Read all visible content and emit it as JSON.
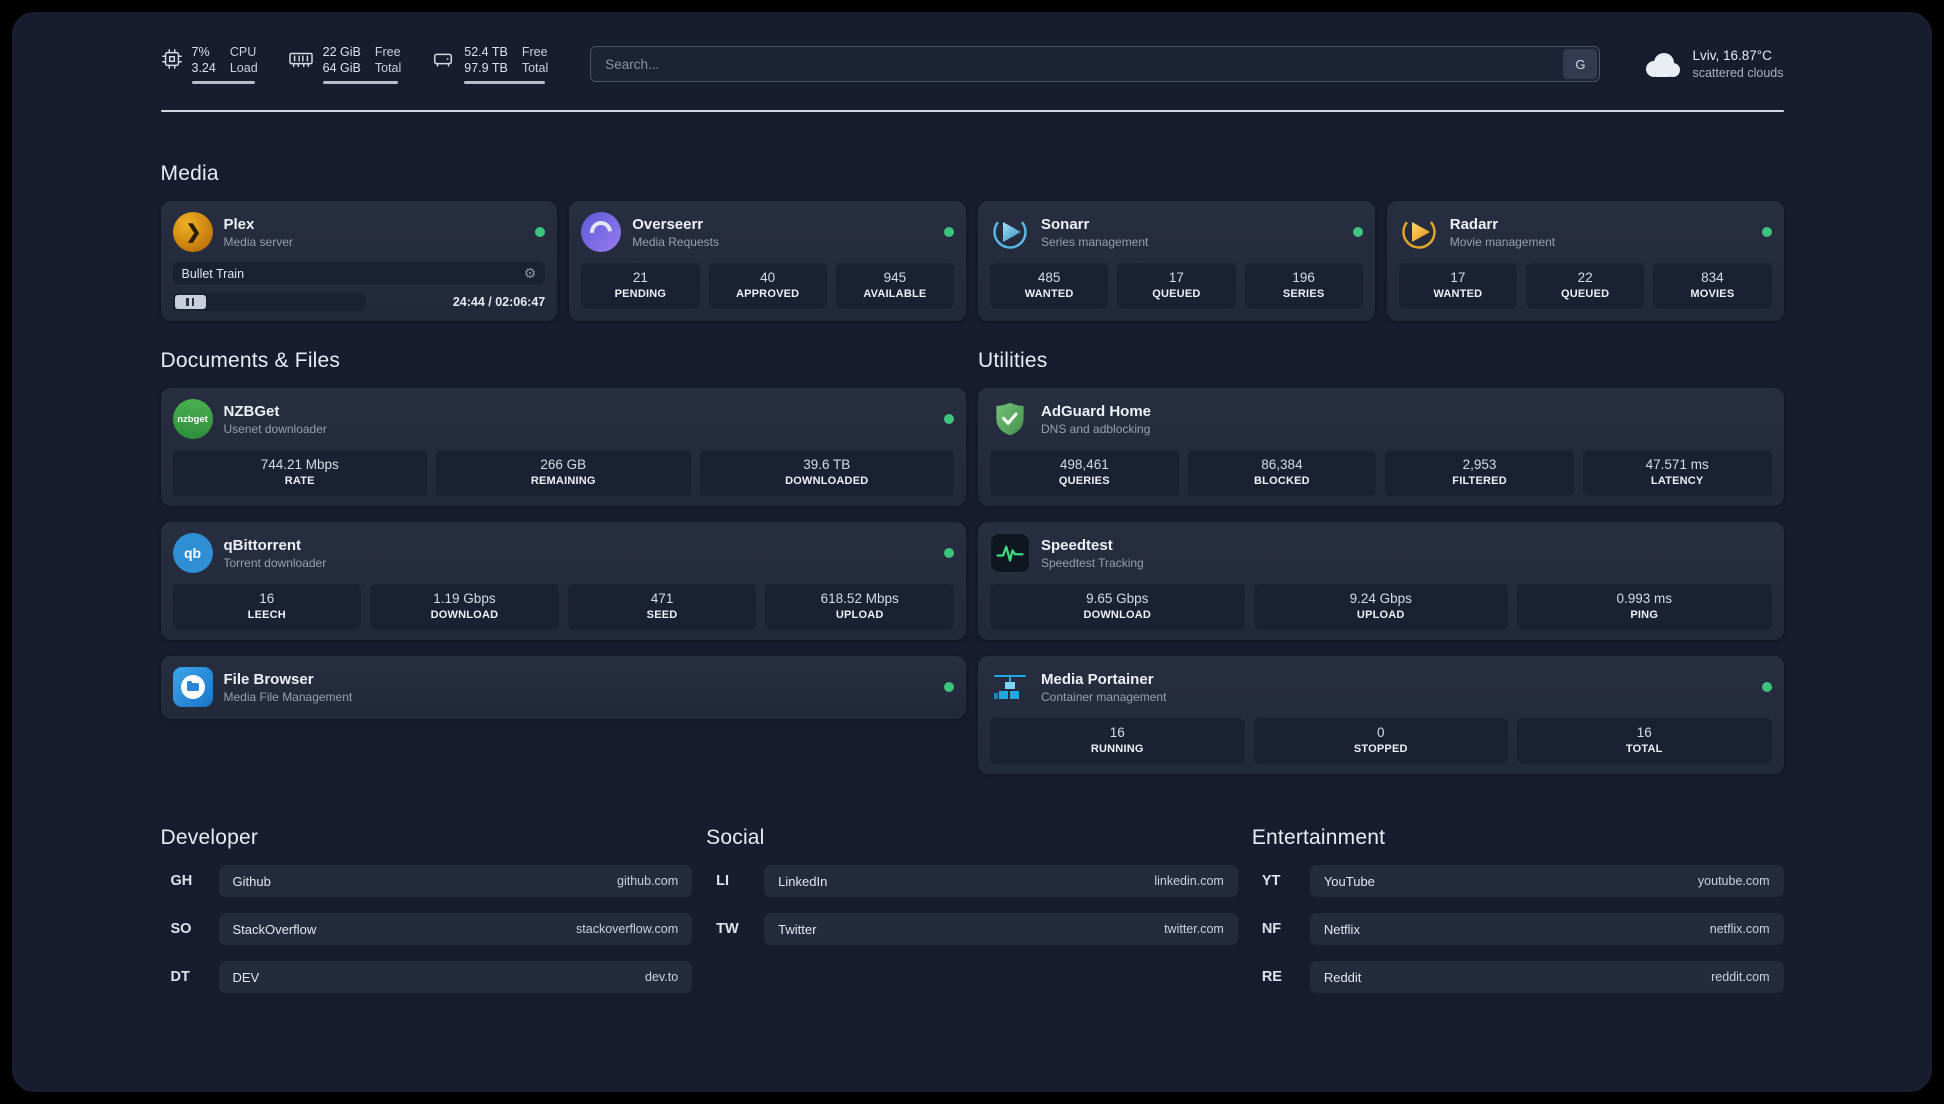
{
  "topbar": {
    "cpu": {
      "value_top": "7%",
      "value_bottom": "3.24",
      "label_top": "CPU",
      "label_bottom": "Load"
    },
    "memory": {
      "value_top": "22 GiB",
      "value_bottom": "64 GiB",
      "label_top": "Free",
      "label_bottom": "Total"
    },
    "disk": {
      "value_top": "52.4 TB",
      "value_bottom": "97.9 TB",
      "label_top": "Free",
      "label_bottom": "Total"
    },
    "search": {
      "placeholder": "Search...",
      "engine_button": "G"
    },
    "weather": {
      "location": "Lviv, 16.87°C",
      "condition": "scattered clouds"
    }
  },
  "sections": {
    "media": {
      "title": "Media",
      "apps": [
        {
          "name": "Plex",
          "subtitle": "Media server",
          "player": {
            "track": "Bullet Train",
            "time": "24:44 / 02:06:47"
          }
        },
        {
          "name": "Overseerr",
          "subtitle": "Media Requests",
          "stats": [
            {
              "value": "21",
              "label": "PENDING"
            },
            {
              "value": "40",
              "label": "APPROVED"
            },
            {
              "value": "945",
              "label": "AVAILABLE"
            }
          ]
        },
        {
          "name": "Sonarr",
          "subtitle": "Series management",
          "stats": [
            {
              "value": "485",
              "label": "WANTED"
            },
            {
              "value": "17",
              "label": "QUEUED"
            },
            {
              "value": "196",
              "label": "SERIES"
            }
          ]
        },
        {
          "name": "Radarr",
          "subtitle": "Movie management",
          "stats": [
            {
              "value": "17",
              "label": "WANTED"
            },
            {
              "value": "22",
              "label": "QUEUED"
            },
            {
              "value": "834",
              "label": "MOVIES"
            }
          ]
        }
      ]
    },
    "documents": {
      "title": "Documents & Files",
      "apps": [
        {
          "name": "NZBGet",
          "subtitle": "Usenet downloader",
          "stats": [
            {
              "value": "744.21 Mbps",
              "label": "RATE"
            },
            {
              "value": "266 GB",
              "label": "REMAINING"
            },
            {
              "value": "39.6 TB",
              "label": "DOWNLOADED"
            }
          ]
        },
        {
          "name": "qBittorrent",
          "subtitle": "Torrent downloader",
          "stats": [
            {
              "value": "16",
              "label": "LEECH"
            },
            {
              "value": "1.19 Gbps",
              "label": "DOWNLOAD"
            },
            {
              "value": "471",
              "label": "SEED"
            },
            {
              "value": "618.52 Mbps",
              "label": "UPLOAD"
            }
          ]
        },
        {
          "name": "File Browser",
          "subtitle": "Media File Management",
          "stats": []
        }
      ]
    },
    "utilities": {
      "title": "Utilities",
      "apps": [
        {
          "name": "AdGuard Home",
          "subtitle": "DNS and adblocking",
          "stats": [
            {
              "value": "498,461",
              "label": "QUERIES"
            },
            {
              "value": "86,384",
              "label": "BLOCKED"
            },
            {
              "value": "2,953",
              "label": "FILTERED"
            },
            {
              "value": "47.571 ms",
              "label": "LATENCY"
            }
          ]
        },
        {
          "name": "Speedtest",
          "subtitle": "Speedtest Tracking",
          "stats": [
            {
              "value": "9.65 Gbps",
              "label": "DOWNLOAD"
            },
            {
              "value": "9.24 Gbps",
              "label": "UPLOAD"
            },
            {
              "value": "0.993 ms",
              "label": "PING"
            }
          ]
        },
        {
          "name": "Media Portainer",
          "subtitle": "Container management",
          "stats": [
            {
              "value": "16",
              "label": "RUNNING"
            },
            {
              "value": "0",
              "label": "STOPPED"
            },
            {
              "value": "16",
              "label": "TOTAL"
            }
          ]
        }
      ]
    }
  },
  "bookmarks": [
    {
      "title": "Developer",
      "items": [
        {
          "abbr": "GH",
          "name": "Github",
          "url": "github.com"
        },
        {
          "abbr": "SO",
          "name": "StackOverflow",
          "url": "stackoverflow.com"
        },
        {
          "abbr": "DT",
          "name": "DEV",
          "url": "dev.to"
        }
      ]
    },
    {
      "title": "Social",
      "items": [
        {
          "abbr": "LI",
          "name": "LinkedIn",
          "url": "linkedin.com"
        },
        {
          "abbr": "TW",
          "name": "Twitter",
          "url": "twitter.com"
        }
      ]
    },
    {
      "title": "Entertainment",
      "items": [
        {
          "abbr": "YT",
          "name": "YouTube",
          "url": "youtube.com"
        },
        {
          "abbr": "NF",
          "name": "Netflix",
          "url": "netflix.com"
        },
        {
          "abbr": "RE",
          "name": "Reddit",
          "url": "reddit.com"
        }
      ]
    }
  ],
  "colors": {
    "panel_background": "#171d2e",
    "card_background": "#242b3c",
    "stat_background": "#1a2132",
    "status_online": "#3fc380",
    "plex_brand": "#e5a00d",
    "adguard_brand": "#68bc71",
    "portainer_brand": "#1fa9e4"
  }
}
